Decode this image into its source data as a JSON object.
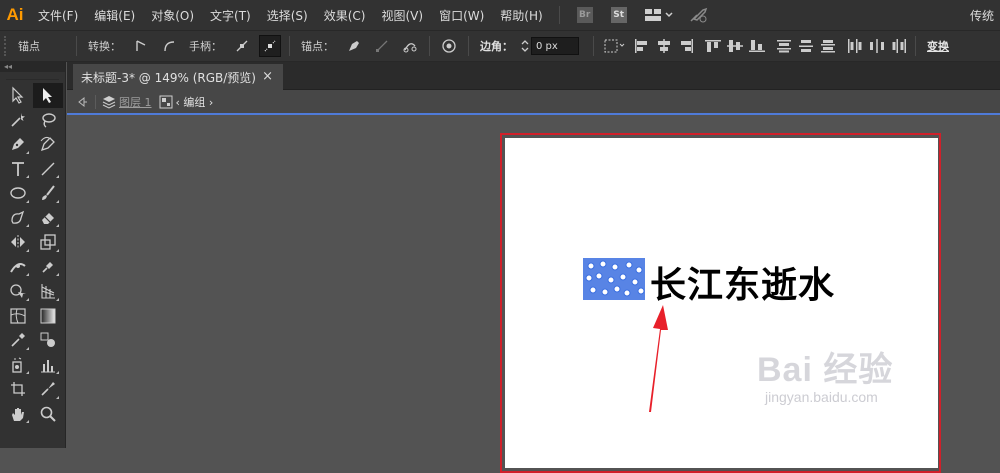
{
  "app": {
    "logo": "Ai",
    "workspace": "传统"
  },
  "menubar": {
    "items": [
      "文件(F)",
      "编辑(E)",
      "对象(O)",
      "文字(T)",
      "选择(S)",
      "效果(C)",
      "视图(V)",
      "窗口(W)",
      "帮助(H)"
    ],
    "icons": {
      "bridge": "Br",
      "stock": "St"
    }
  },
  "controlbar": {
    "selection_type": "锚点",
    "convert_label": "转换：",
    "handles_label": "手柄：",
    "anchors_label": "锚点：",
    "corner_label": "边角：",
    "corner_value": "0 px",
    "transform_label": "变换"
  },
  "document": {
    "tab_title": "未标题-3* @ 149% (RGB/预览)",
    "close_glyph": "×",
    "breadcrumb": {
      "layer": "图层 1",
      "group": "编组"
    }
  },
  "artboard": {
    "text": "长江东逝水"
  },
  "watermark": {
    "brand": "Bai 经验",
    "url": "jingyan.baidu.com"
  },
  "colors": {
    "accent": "#4f7bd9",
    "artboard_border": "#d0202a",
    "arrow": "#e8202a",
    "selection": "#3b6fe0"
  }
}
